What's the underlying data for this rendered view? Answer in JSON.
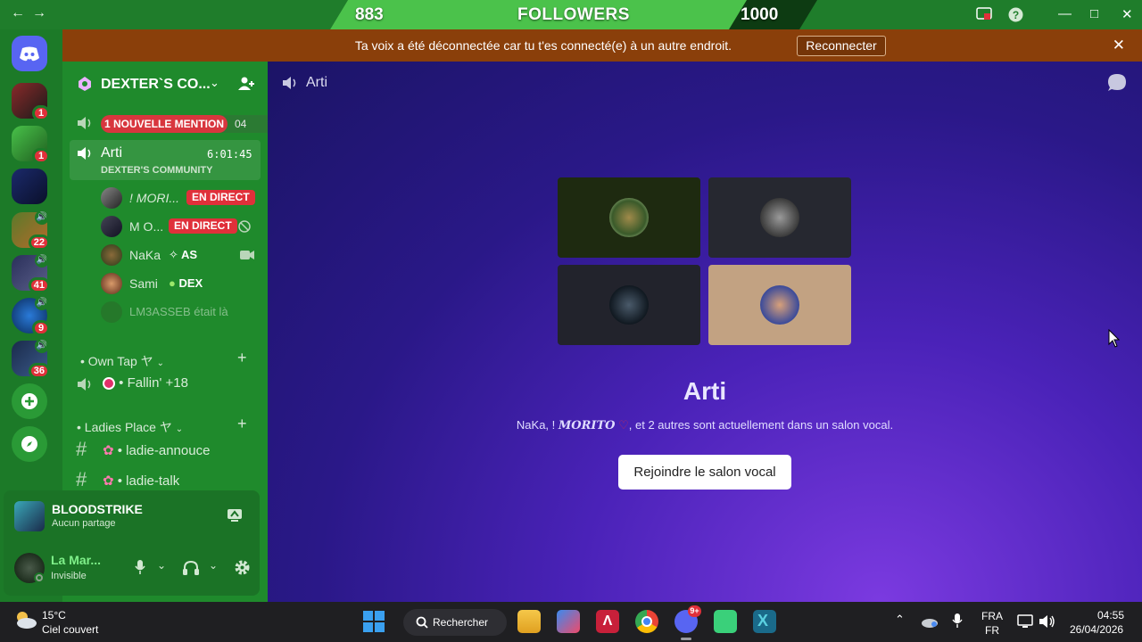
{
  "titlebar": {
    "back_icon": "arrow-left-icon",
    "forward_icon": "arrow-right-icon",
    "followers": {
      "current": "883",
      "label": "FOLLOWERS",
      "goal": "1000",
      "progress": 0.883
    },
    "help_icon": "question-icon"
  },
  "notice": {
    "text": "Ta voix a été déconnectée car tu t'es connecté(e) à un autre endroit.",
    "reconnect_label": "Reconnecter",
    "close_icon": "close-icon"
  },
  "rail": {
    "servers": [
      {
        "badge": "1"
      },
      {
        "badge": "1"
      },
      {
        "badge": ""
      },
      {
        "badge": "22"
      },
      {
        "badge": "41"
      },
      {
        "badge": "9"
      },
      {
        "badge": "36"
      }
    ]
  },
  "sidebar": {
    "server_name": "DEXTER`S CO...",
    "mention_label": "1 NOUVELLE MENTION",
    "mention_channel_num": "04",
    "active_channel": {
      "name": "Arti",
      "timer": "6:01:45",
      "server": "DEXTER'S COMMUNITY"
    },
    "members": [
      {
        "name": "! MORI...",
        "badge": "EN DIRECT"
      },
      {
        "name": "M O...",
        "badge": "EN DIRECT"
      },
      {
        "name": "NaKa",
        "tag": "AS"
      },
      {
        "name": "Sami",
        "tag": "DEX"
      },
      {
        "name": "LM3ASSEB était là"
      }
    ],
    "categories": [
      {
        "name": "Own Tap ヤ"
      },
      {
        "name": "Ladies Place ヤ"
      }
    ],
    "channels": [
      {
        "name": "Fallin' +18"
      },
      {
        "name": "ladie-annouce"
      },
      {
        "name": "ladie-talk"
      }
    ]
  },
  "user_panel": {
    "game": "BLOODSTRIKE",
    "game_status": "Aucun partage",
    "username": "La Mar...",
    "status": "Invisible"
  },
  "main": {
    "channel_title": "Arti",
    "vc_title": "Arti",
    "desc_prefix": "NaKa, !",
    "desc_name": "MORITO",
    "desc_suffix": ", et 2 autres sont actuellement dans un salon vocal.",
    "join_label": "Rejoindre le salon vocal"
  },
  "taskbar": {
    "weather_temp": "15°C",
    "weather_desc": "Ciel couvert",
    "search_label": "Rechercher",
    "lang_top": "FRA",
    "lang_bottom": "FR",
    "time": "04:55",
    "date": "26/04/2026",
    "discord_badge": "9+"
  },
  "colors": {
    "accent_green": "#1f8a2c",
    "banner_brown": "#8a3f0a",
    "live_red": "#e0303a",
    "vc_purple": "#4a22b8"
  }
}
